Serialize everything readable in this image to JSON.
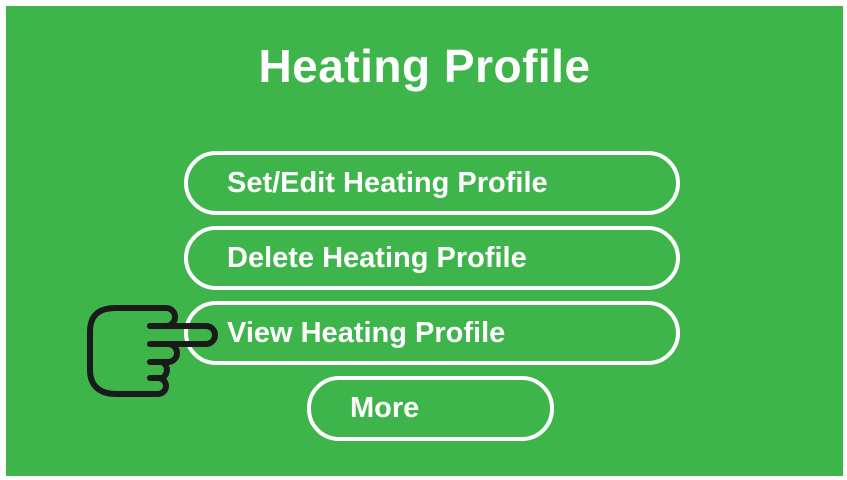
{
  "screen": {
    "title": "Heating Profile",
    "background_color": "#3db54a",
    "accent_color": "#ffffff"
  },
  "menu": {
    "items": [
      {
        "label": "Set/Edit Heating Profile"
      },
      {
        "label": "Delete Heating Profile"
      },
      {
        "label": "View Heating Profile"
      }
    ],
    "more_label": "More"
  },
  "pointer": {
    "icon": "pointing-hand-icon",
    "points_to": "View Heating Profile"
  }
}
